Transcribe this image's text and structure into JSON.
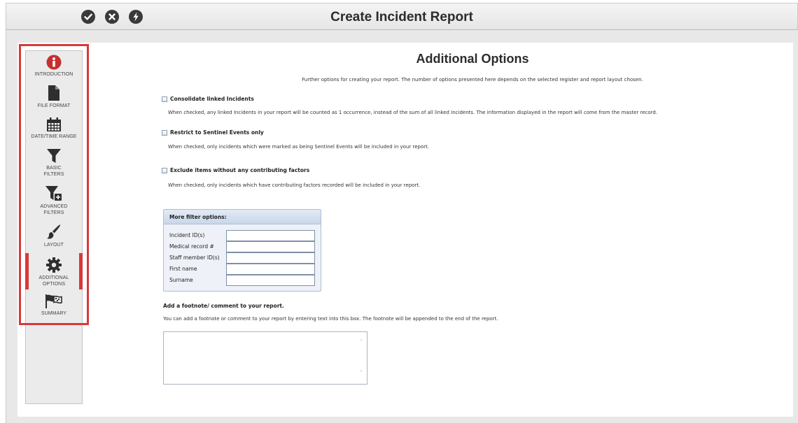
{
  "window": {
    "title": "Create Incident Report",
    "toolbar_icons": [
      "check-circle-icon",
      "close-circle-icon",
      "bolt-circle-icon"
    ]
  },
  "sidebar": {
    "items": [
      {
        "label": "INTRODUCTION",
        "icon": "info-icon"
      },
      {
        "label": "FILE FORMAT",
        "icon": "file-icon"
      },
      {
        "label": "DATE/TIME RANGE",
        "icon": "calendar-icon"
      },
      {
        "label": "BASIC FILTERS",
        "icon": "filter-icon"
      },
      {
        "label": "ADVANCED FILTERS",
        "icon": "filter-plus-icon"
      },
      {
        "label": "LAYOUT",
        "icon": "brush-icon"
      },
      {
        "label": "ADDITIONAL OPTIONS",
        "icon": "gear-icon"
      },
      {
        "label": "SUMMARY",
        "icon": "flags-icon"
      }
    ],
    "active_item": "ADDITIONAL OPTIONS"
  },
  "main": {
    "heading": "Additional Options",
    "subtitle": "Further options for creating your report. The number of options presented here depends on the selected register and report layout chosen.",
    "options": [
      {
        "label": "Consolidate linked Incidents",
        "checked": false,
        "description": "When checked, any linked Incidents in your report will be counted as 1 occurrence, instead of the sum of all linked Incidents. The information displayed in the report will come from the master record."
      },
      {
        "label": "Restrict to Sentinel Events only",
        "checked": false,
        "description": "When checked, only incidents which were marked as being Sentinel Events will be included in your report."
      },
      {
        "label": "Exclude items without any contributing factors",
        "checked": false,
        "description": "When checked, only incidents which have contributing factors recorded will be included in your report."
      }
    ],
    "filter_box": {
      "title": "More filter options:",
      "fields": [
        {
          "label": "Incident ID(s)",
          "value": ""
        },
        {
          "label": "Medical record #",
          "value": ""
        },
        {
          "label": "Staff member ID(s)",
          "value": ""
        },
        {
          "label": "First name",
          "value": ""
        },
        {
          "label": "Surname",
          "value": ""
        }
      ]
    },
    "footnote": {
      "title": "Add a footnote/ comment to your report.",
      "description": "You can add a footnote or comment to your report by entering text into this box. The footnote will be appended to the end of the report.",
      "value": ""
    }
  },
  "colors": {
    "highlight": "#d9383a",
    "info_icon": "#c62f2f",
    "icon_dark": "#2f2f2f",
    "filter_box_bg": "#eef2f8"
  }
}
